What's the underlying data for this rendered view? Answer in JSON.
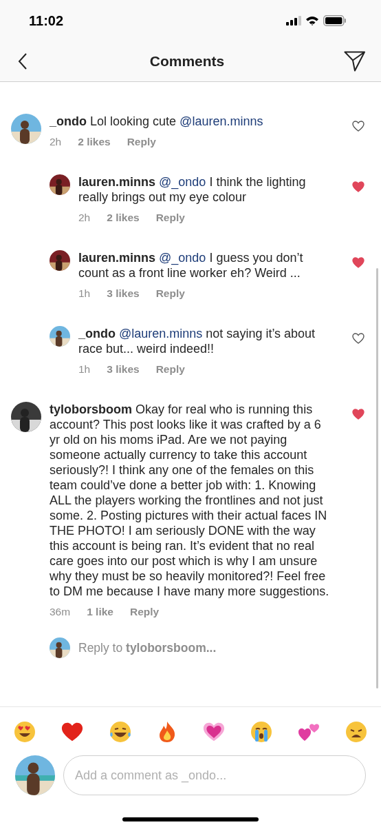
{
  "status_bar": {
    "time": "11:02"
  },
  "header": {
    "title": "Comments"
  },
  "comments": [
    {
      "user": "_ondo",
      "parts": [
        {
          "kind": "text",
          "text": "Lol looking cute "
        },
        {
          "kind": "mention",
          "text": "@lauren.minns"
        }
      ],
      "time": "2h",
      "likes": "2 likes",
      "reply": "Reply",
      "liked": false,
      "children": [
        {
          "user": "lauren.minns",
          "parts": [
            {
              "kind": "mention",
              "text": "@_ondo"
            },
            {
              "kind": "text",
              "text": " I think the lighting really brings out my eye colour"
            }
          ],
          "time": "2h",
          "likes": "2 likes",
          "reply": "Reply",
          "liked": true
        },
        {
          "user": "lauren.minns",
          "parts": [
            {
              "kind": "mention",
              "text": "@_ondo"
            },
            {
              "kind": "text",
              "text": " I guess you don’t count as a front line worker eh? Weird ..."
            }
          ],
          "time": "1h",
          "likes": "3 likes",
          "reply": "Reply",
          "liked": true
        },
        {
          "user": "_ondo",
          "parts": [
            {
              "kind": "mention",
              "text": "@lauren.minns"
            },
            {
              "kind": "text",
              "text": " not saying it’s about race but... weird indeed!!"
            }
          ],
          "time": "1h",
          "likes": "3 likes",
          "reply": "Reply",
          "liked": false
        }
      ]
    },
    {
      "user": "tyloborsboom",
      "parts": [
        {
          "kind": "text",
          "text": "Okay for real who is running this account? This post looks like it was crafted by a 6 yr old on his moms iPad. Are we not paying someone actually currency to take this account seriously?! I think any one of the females on this team could’ve done a better job with: 1. Knowing ALL the players working the frontlines and not just some. 2. Posting pictures with their actual faces IN THE PHOTO! I am seriously DONE with the way this account is being ran. It’s evident that no real care goes into our post which is why I am unsure why they must be so heavily monitored?! Feel free to DM me because I have many more suggestions."
        }
      ],
      "time": "36m",
      "likes": "1 like",
      "reply": "Reply",
      "liked": true,
      "reply_prompt": "Reply to **tyloborsboom...**"
    }
  ],
  "emoji_bar": [
    {
      "kind": "heart-eyes"
    },
    {
      "kind": "heart"
    },
    {
      "kind": "laughing"
    },
    {
      "kind": "fire"
    },
    {
      "kind": "pink-heart"
    },
    {
      "kind": "crying"
    },
    {
      "kind": "two-hearts"
    },
    {
      "kind": "weary"
    }
  ],
  "composer": {
    "placeholder": "Add a comment as _ondo..."
  }
}
